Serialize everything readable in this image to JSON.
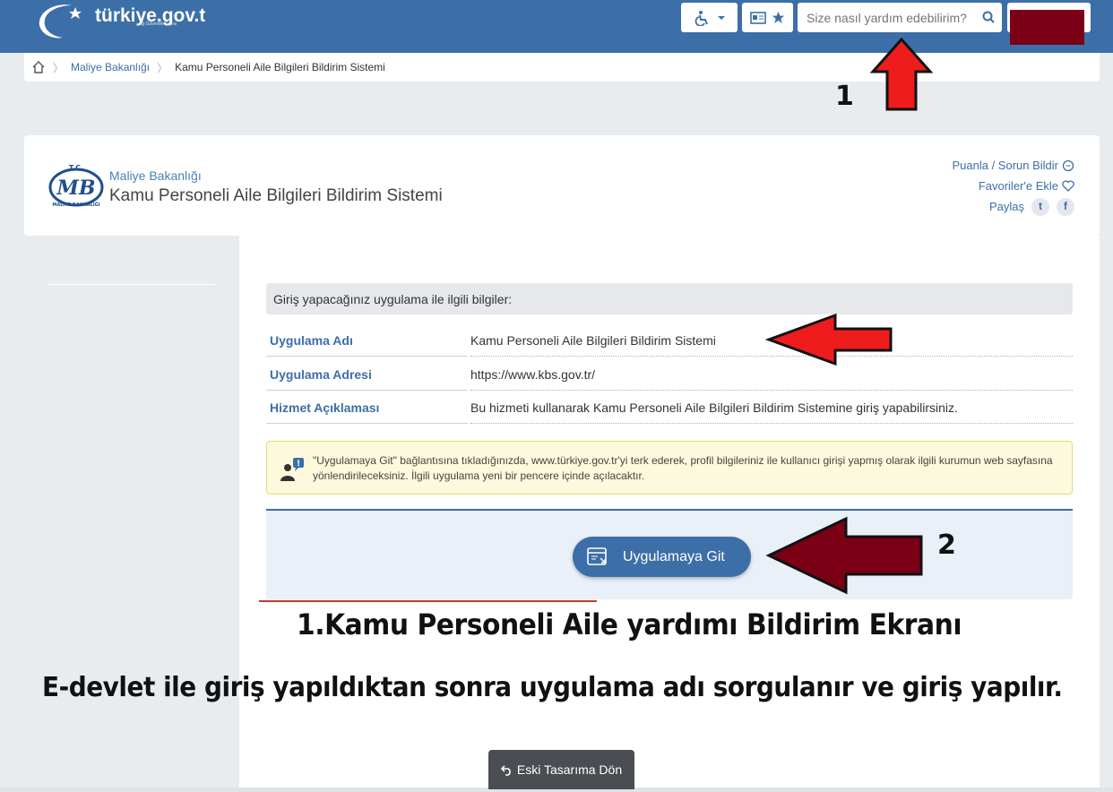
{
  "header": {
    "logo_text": "türkiye.gov.t",
    "logo_sub": "Ağ Güvenlik Kapısı",
    "search_placeholder": "Size nasıl yardım edebilirim?",
    "accent": "#3c6fa7"
  },
  "breadcrumb": {
    "items": [
      "Maliye Bakanlığı",
      "Kamu Personeli Aile Bilgileri Bildirim Sistemi"
    ]
  },
  "service": {
    "logo_tc": "T.C.",
    "logo_mb": "MB",
    "logo_ring": "MALİYE BAKANLIĞI",
    "organization": "Maliye Bakanlığı",
    "title": "Kamu Personeli Aile Bilgileri Bildirim Sistemi",
    "rate_link": "Puanla / Sorun Bildir",
    "favorite_link": "Favoriler'e Ekle",
    "share_label": "Paylaş",
    "twitter_glyph": "t",
    "facebook_glyph": "f"
  },
  "info": {
    "heading": "Giriş yapacağınız uygulama ile ilgili bilgiler:",
    "rows": [
      {
        "key": "Uygulama Adı",
        "value": "Kamu Personeli Aile Bilgileri Bildirim Sistemi"
      },
      {
        "key": "Uygulama Adresi",
        "value": "https://www.kbs.gov.tr/"
      },
      {
        "key": "Hizmet Açıklaması",
        "value": "Bu hizmeti kullanarak Kamu Personeli Aile Bilgileri Bildirim Sistemine giriş yapabilirsiniz."
      }
    ],
    "notice": "\"Uygulamaya Git\" bağlantısına tıkladığınızda, www.türkiye.gov.tr'yi terk ederek, profil bilgileriniz ile kullanıcı girişi yapmış olarak ilgili kurumun web sayfasına yönlendirileceksiniz. İlgili uygulama yeni bir pencere içinde açılacaktır.",
    "go_button": "Uygulamaya Git"
  },
  "annotations": {
    "marker_1": "1",
    "marker_2": "2",
    "caption_title": "1.Kamu Personeli Aile yardımı Bildirim Ekranı",
    "caption_body": "E-devlet ile giriş yapıldıktan sonra uygulama adı sorgulanır ve giriş yapılır.",
    "arrow_red": "#ee1c1c",
    "arrow_dark": "#7b0016"
  },
  "footer": {
    "old_design_button": "Eski Tasarıma Dön"
  }
}
